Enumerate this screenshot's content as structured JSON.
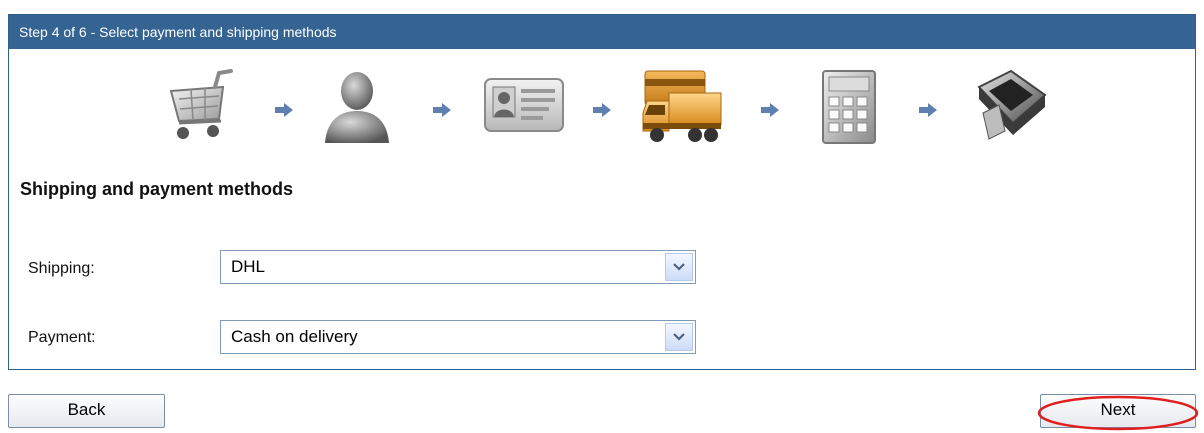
{
  "header": {
    "title": "Step 4 of 6 - Select payment and shipping methods"
  },
  "steps": [
    {
      "icon": "shopping-cart-icon"
    },
    {
      "icon": "user-icon"
    },
    {
      "icon": "id-card-icon"
    },
    {
      "icon": "delivery-truck-icon",
      "active": true
    },
    {
      "icon": "calculator-icon"
    },
    {
      "icon": "card-terminal-icon"
    }
  ],
  "section": {
    "title": "Shipping and payment methods"
  },
  "form": {
    "shipping": {
      "label": "Shipping:",
      "value": "DHL"
    },
    "payment": {
      "label": "Payment:",
      "value": "Cash on delivery"
    }
  },
  "buttons": {
    "back": "Back",
    "next": "Next"
  },
  "colors": {
    "header_bg": "#366492",
    "active_step": "#e8a33a",
    "highlight": "#e02020"
  }
}
